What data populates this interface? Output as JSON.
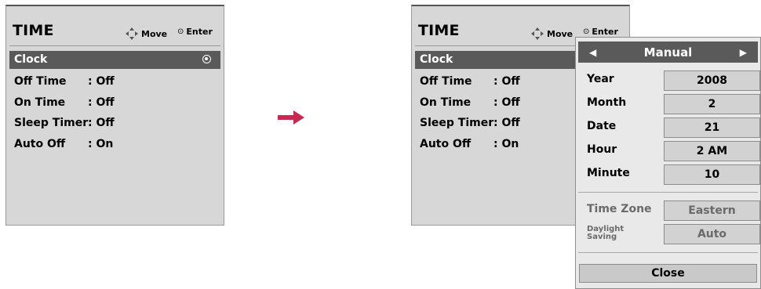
{
  "left_panel": {
    "title": "TIME",
    "hint_move": "Move",
    "hint_enter": "Enter",
    "items": [
      {
        "label": "Clock",
        "value": ""
      },
      {
        "label": "Off Time",
        "value": ": Off"
      },
      {
        "label": "On Time",
        "value": ": Off"
      },
      {
        "label": "Sleep Timer",
        "value": ": Off"
      },
      {
        "label": "Auto Off",
        "value": ": On"
      }
    ]
  },
  "right_panel": {
    "title": "TIME",
    "hint_move": "Move",
    "hint_enter": "Enter",
    "items": [
      {
        "label": "Clock",
        "value": ""
      },
      {
        "label": "Off Time",
        "value": ": Off"
      },
      {
        "label": "On Time",
        "value": ": Off"
      },
      {
        "label": "Sleep Timer",
        "value": ": Off"
      },
      {
        "label": "Auto Off",
        "value": ": On"
      }
    ]
  },
  "clock_submenu": {
    "mode": "Manual",
    "fields": [
      {
        "label": "Year",
        "value": "2008"
      },
      {
        "label": "Month",
        "value": "2"
      },
      {
        "label": "Date",
        "value": "21"
      },
      {
        "label": "Hour",
        "value": "2 AM"
      },
      {
        "label": "Minute",
        "value": "10"
      }
    ],
    "time_zone": {
      "label": "Time Zone",
      "value": "Eastern"
    },
    "daylight_saving": {
      "label": "Daylight Saving",
      "value": "Auto"
    },
    "close_label": "Close"
  },
  "colors": {
    "panel_bg": "#d7d7d7",
    "highlight": "#5a5a5a",
    "arrow": "#c8294f"
  }
}
